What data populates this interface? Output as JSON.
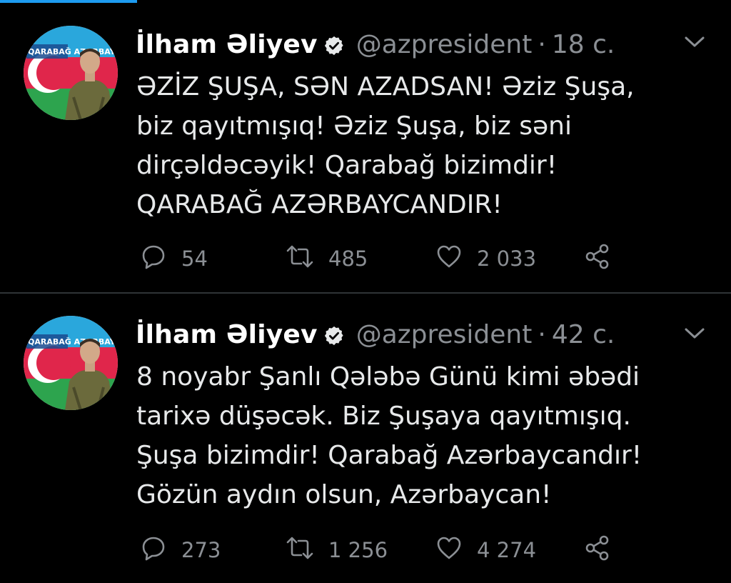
{
  "colors": {
    "background": "#000000",
    "divider": "#2f3336",
    "name": "#ffffff",
    "text": "#e7e9ea",
    "secondary": "#8b8f94",
    "accent": "#1d9bf0"
  },
  "tweets": [
    {
      "author": {
        "name": "İlham Əliyev",
        "handle": "@azpresident",
        "verified": true
      },
      "separator": "·",
      "timestamp": "18 c.",
      "avatar": {
        "banner_text": "QARABAĞ AZƏRBAYCANDIR!"
      },
      "text_lines": [
        "ƏZİZ ŞUŞA, SƏN AZADSAN! Əziz Şuşa,",
        "biz qayıtmışıq! Əziz Şuşa, biz səni",
        "dirçəldəcəyik! Qarabağ bizimdir!",
        "QARABAĞ AZƏRBAYCANDIR!"
      ],
      "actions": {
        "reply_count": "54",
        "retweet_count": "485",
        "like_count": "2 033",
        "reply_icon": "reply-icon",
        "retweet_icon": "retweet-icon",
        "like_icon": "heart-icon",
        "share_icon": "share-icon"
      }
    },
    {
      "author": {
        "name": "İlham Əliyev",
        "handle": "@azpresident",
        "verified": true
      },
      "separator": "·",
      "timestamp": "42 c.",
      "avatar": {
        "banner_text": "QARABAĞ AZƏRBAYCANDIR!"
      },
      "text_lines": [
        "8 noyabr Şanlı Qələbə Günü kimi əbədi",
        "tarixə düşəcək. Biz Şuşaya qayıtmışıq.",
        "Şuşa bizimdir! Qarabağ Azərbaycandır!",
        "Gözün aydın olsun, Azərbaycan!"
      ],
      "actions": {
        "reply_count": "273",
        "retweet_count": "1 256",
        "like_count": "4 274",
        "reply_icon": "reply-icon",
        "retweet_icon": "retweet-icon",
        "like_icon": "heart-icon",
        "share_icon": "share-icon"
      }
    }
  ]
}
